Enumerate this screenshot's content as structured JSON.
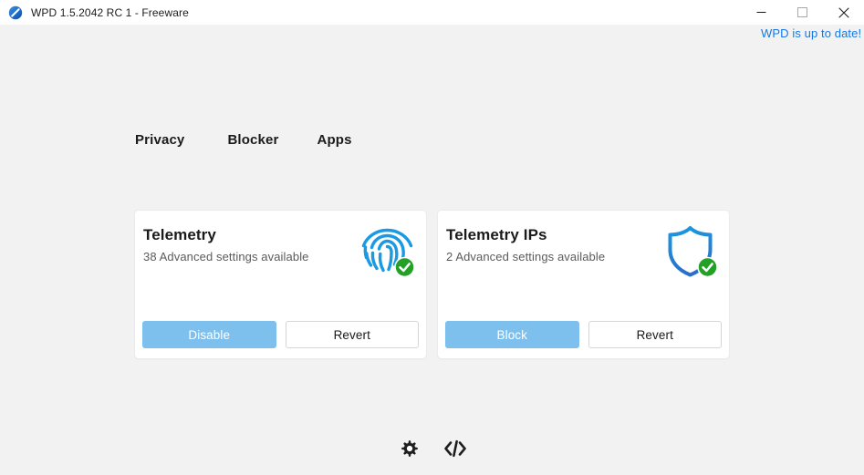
{
  "window": {
    "title": "WPD 1.5.2042 RC 1 - Freeware",
    "app_icon": "wpd-block-circle-icon",
    "controls": {
      "minimize": "minimize-icon",
      "maximize": "maximize-icon",
      "close": "close-icon"
    }
  },
  "banner": {
    "update_text": "WPD is up to date!",
    "color": "#1779e3"
  },
  "tabs": [
    {
      "label": "Privacy",
      "active": true
    },
    {
      "label": "Blocker",
      "active": false
    },
    {
      "label": "Apps",
      "active": false
    }
  ],
  "cards": [
    {
      "title": "Telemetry",
      "subtitle": "38 Advanced settings available",
      "icon": "fingerprint-icon",
      "status_badge": "check-circle-icon",
      "primary_button": "Disable",
      "secondary_button": "Revert"
    },
    {
      "title": "Telemetry IPs",
      "subtitle": "2 Advanced settings available",
      "icon": "shield-icon",
      "status_badge": "check-circle-icon",
      "primary_button": "Block",
      "secondary_button": "Revert"
    }
  ],
  "footer": {
    "settings_icon": "gear-icon",
    "code_icon": "code-brackets-icon"
  },
  "colors": {
    "page_background": "#f2f2f2",
    "titlebar_background": "#ffffff",
    "card_background": "#ffffff",
    "accent_blue": "#1a9ae2",
    "primary_button": "#7dc0ee",
    "status_green": "#23a127",
    "link_blue": "#1779e3",
    "text_primary": "#1a1a1a",
    "text_secondary": "#5b5b5b"
  }
}
